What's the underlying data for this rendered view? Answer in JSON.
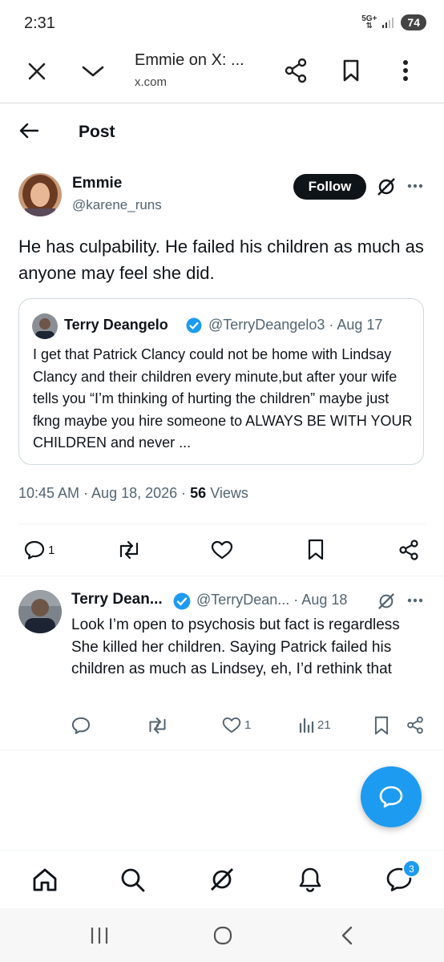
{
  "status_bar": {
    "time": "2:31",
    "network": "5G+",
    "battery": "74"
  },
  "browser": {
    "title": "Emmie on X: ...",
    "url": "x.com"
  },
  "header": {
    "title": "Post"
  },
  "tweet": {
    "name": "Emmie",
    "handle": "@karene_runs",
    "follow_label": "Follow",
    "text": "He has culpability. He failed his children as much as anyone may feel she did.",
    "quote": {
      "name": "Terry Deangelo",
      "handle_date": "@TerryDeangelo3 · Aug 17",
      "text": "I get that Patrick Clancy could not be home with Lindsay Clancy and their children every minute,but after your wife tells you “I’m thinking of hurting the children” maybe just fkng maybe you hire someone to ALWAYS BE WITH YOUR CHILDREN and never ..."
    },
    "timestamp": "10:45 AM · Aug 18, 2026 · ",
    "views_count": "56",
    "views_label": " Views",
    "replies_count": "1"
  },
  "reply": {
    "name": "Terry Dean...",
    "handle_date": "@TerryDean... · Aug 18",
    "text": "Look I’m open to psychosis but fact is regardless She killed her children. Saying Patrick failed his children as much as Lindsey, eh, I’d rethink that",
    "likes": "1",
    "views": "21"
  },
  "nav": {
    "messages_badge": "3"
  },
  "colors": {
    "accent": "#1d9bf0",
    "verified": "#1d9bf0",
    "text": "#0f1419",
    "muted": "#536471"
  }
}
